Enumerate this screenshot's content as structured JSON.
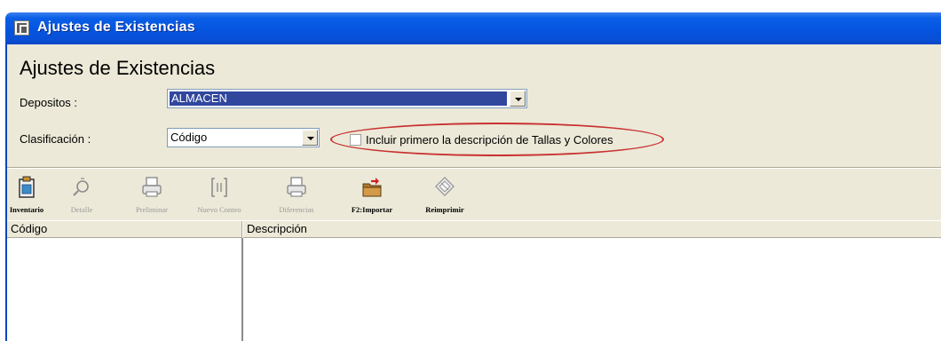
{
  "window": {
    "title": "Ajustes de Existencias"
  },
  "form": {
    "heading": "Ajustes de Existencias",
    "depositos": {
      "label": "Depositos :",
      "value": "ALMACEN"
    },
    "clasificacion": {
      "label": "Clasificación :",
      "value": "Código"
    },
    "incluir": {
      "label": "Incluir primero la descripción de Tallas y Colores",
      "checked": false
    }
  },
  "toolbar": {
    "items": [
      {
        "label": "Inventario",
        "enabled": true,
        "icon": "clipboard-icon"
      },
      {
        "label": "Detalle",
        "enabled": false,
        "icon": "magnifier-icon"
      },
      {
        "label": "Preliminar",
        "enabled": false,
        "icon": "printer-icon"
      },
      {
        "label": "Nuevo Conteo",
        "enabled": false,
        "icon": "bracket-icon"
      },
      {
        "label": "Diferencias",
        "enabled": false,
        "icon": "printer-icon"
      },
      {
        "label": "F2:Importar",
        "enabled": true,
        "icon": "folder-import-icon"
      },
      {
        "label": "Reimprimir",
        "enabled": true,
        "icon": "reprint-icon"
      }
    ]
  },
  "list": {
    "columns": [
      "Código",
      "Descripción"
    ],
    "rows": []
  },
  "colors": {
    "titlebar": "#0554e0",
    "selection": "#31479e",
    "annotation": "#c83232"
  }
}
